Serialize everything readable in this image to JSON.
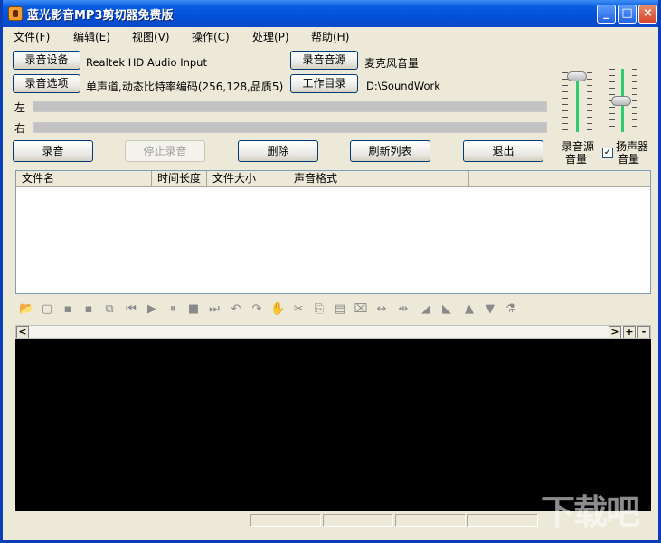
{
  "window": {
    "title": "蓝光影音MP3剪切器免费版",
    "minimize_label": "_",
    "maximize_label": "□",
    "close_label": "×"
  },
  "menu": [
    "文件(F)",
    "编辑(E)",
    "视图(V)",
    "操作(C)",
    "处理(P)",
    "帮助(H)"
  ],
  "device": {
    "record_device_label": "录音设备",
    "record_device_value": "Realtek HD Audio Input",
    "record_source_label": "录音音源",
    "record_source_value": "麦克风音量",
    "record_options_label": "录音选项",
    "record_options_value": "单声道,动态比特率编码(256,128,品质5)",
    "work_dir_label": "工作目录",
    "work_dir_value": "D:\\SoundWork"
  },
  "meters": {
    "left_label": "左",
    "right_label": "右"
  },
  "actions": {
    "record": "录音",
    "stop": "停止录音",
    "delete": "删除",
    "refresh": "刷新列表",
    "exit": "退出"
  },
  "volume": {
    "source_label_1": "录音源",
    "source_label_2": "音量",
    "speaker_label_1": "扬声器",
    "speaker_label_2": "音量",
    "speaker_checked": true,
    "source_level": 0.95,
    "speaker_level": 0.5
  },
  "file_list": {
    "columns": [
      "文件名",
      "时间长度",
      "文件大小",
      "声音格式"
    ],
    "rows": []
  },
  "toolbar_icons": [
    "open-folder-icon",
    "new-file-icon",
    "save-icon",
    "save-as-icon",
    "export-icon",
    "skip-start-icon",
    "play-icon",
    "pause-icon",
    "stop-icon",
    "skip-end-icon",
    "undo-icon",
    "redo-icon",
    "hand-icon",
    "cut-icon",
    "copy-icon",
    "paste-icon",
    "delete-selection-icon",
    "insert-silence-icon",
    "trim-icon",
    "fade-in-icon",
    "fade-out-icon",
    "volume-up-icon",
    "volume-down-icon",
    "effects-icon"
  ],
  "scroll": {
    "left": "<",
    "right": ">",
    "zoom_in": "+",
    "zoom_out": "-"
  },
  "watermark": "下载吧"
}
